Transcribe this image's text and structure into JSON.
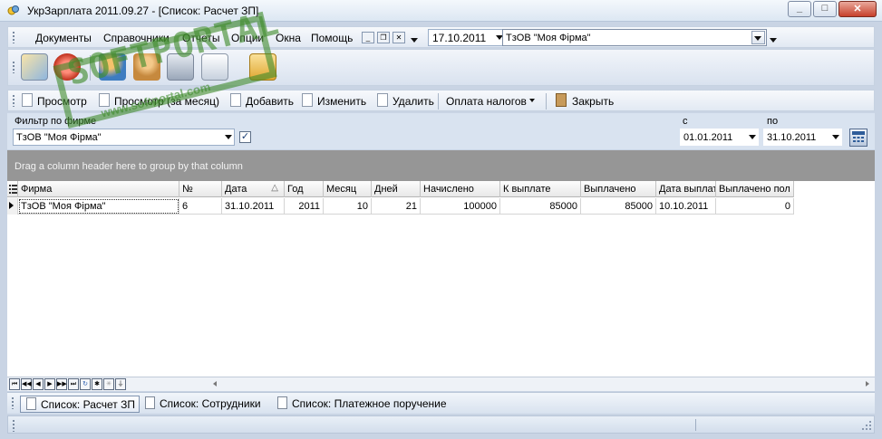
{
  "window": {
    "title": "УкрЗарплата 2011.09.27 - [Список: Расчет ЗП]",
    "controls": {
      "minimize": "_",
      "maximize": "□",
      "close": "✕"
    }
  },
  "menu": {
    "items": [
      "Документы",
      "Справочники",
      "Отчеты",
      "Опции",
      "Окна",
      "Помощь"
    ],
    "mdi_controls": [
      "_",
      "❐",
      "✕"
    ],
    "date": "17.10.2011",
    "firm": "ТзОВ \"Моя Фірма\""
  },
  "toolbar": {
    "view": "Просмотр",
    "view_month": "Просмотр (за месяц)",
    "add": "Добавить",
    "edit": "Изменить",
    "delete": "Удалить",
    "taxes": "Оплата налогов",
    "close": "Закрыть"
  },
  "filter": {
    "firm_label": "Фильтр по фирме",
    "firm_value": "ТзОВ \"Моя Фірма\"",
    "firm_checked": "✓",
    "from_label": "с",
    "from_value": "01.01.2011",
    "to_label": "по",
    "to_value": "31.10.2011"
  },
  "group_panel_text": "Drag a column header here to group by that column",
  "grid": {
    "columns": [
      "Фирма",
      "№",
      "Дата",
      "Год",
      "Месяц",
      "Дней",
      "Начислено",
      "К выплате",
      "Выплачено",
      "Дата выплат",
      "Выплачено пол"
    ],
    "sort_indicator": "△",
    "rows": [
      [
        "ТзОВ \"Моя Фірма\"",
        "6",
        "31.10.2011",
        "2011",
        "10",
        "21",
        "100000",
        "85000",
        "85000",
        "10.10.2011",
        "0"
      ]
    ]
  },
  "navigator": [
    "⏮",
    "◀◀",
    "◀",
    "▶",
    "▶▶",
    "⏭",
    "↻",
    "✱",
    "✳",
    "⏚"
  ],
  "tabs": [
    "Список: Расчет ЗП",
    "Список: Сотрудники",
    "Список: Платежное поручение"
  ],
  "watermark": {
    "brand": "SOFTPORTAL",
    "url": "www.softportal.com"
  }
}
